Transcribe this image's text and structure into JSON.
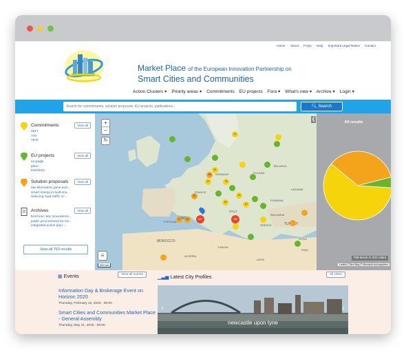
{
  "header": {
    "toplinks": [
      "Home",
      "About",
      "FAQs",
      "Help",
      "Important Legal Notice",
      "Contact"
    ],
    "title_main": "Market Place",
    "title_suffix": "of the European Innovation Partnership on",
    "title_line2": "Smart Cities and Communities",
    "nav": [
      "Action Clusters ▾",
      "Priority areas ▾",
      "Commitments",
      "EU projects",
      "Fora ▾",
      "What's new ▾",
      "Archive ▾",
      "Login ▾"
    ]
  },
  "search": {
    "placeholder": "Search for commitments, solution proposals, EU projects, publications...",
    "button_label": "Search"
  },
  "sidebar": {
    "commitments": {
      "title": "Commitments",
      "view_all": "View all",
      "items": [
        "4817",
        "770",
        "7570"
      ]
    },
    "eu_projects": {
      "title": "EU projects",
      "view_all": "View all",
      "items": [
        "eu-gugle",
        "pleec",
        "transform"
      ]
    },
    "solution_proposals": {
      "title": "Solution proposals",
      "view_all": "View all",
      "items": [
        "taxi kilometers, jams and...",
        "smart energy in built env...",
        "reducing road traffic re..."
      ]
    },
    "archives": {
      "title": "Archives",
      "view_all": "View all",
      "items": [
        "brochure: key innovations...",
        "public procurement for sm...",
        "integrated action plan -..."
      ]
    },
    "view_all_results": "View all 763 results"
  },
  "map": {
    "countries": [
      "FRANCE",
      "SPAIN",
      "PORTUGAL",
      "ITALY",
      "GERMANY",
      "POLAND",
      "UKRAINE",
      "BELARUS",
      "ROMANIA",
      "TURKEY",
      "GREECE",
      "MOROCCO",
      "ALGERIA",
      "TUNISIA",
      "LIBYA",
      "IRAQ",
      "SYRIA",
      "BULGARIA"
    ],
    "cluster_labels": [
      "11",
      "107",
      "126",
      "37",
      "79",
      "27",
      "39",
      "17",
      "20",
      "21",
      "22",
      "13",
      "12"
    ],
    "scale": "500 km"
  },
  "results": {
    "label": "All results",
    "items_count": "789 items in 322 cities",
    "attribution": "Leaflet | Tiles Bing © Microsoft and suppliers",
    "pie": [
      {
        "name": "commitments",
        "share": 0.6,
        "color": "#f6d40c"
      },
      {
        "name": "solution proposals",
        "share": 0.35,
        "color": "#f3a41a"
      },
      {
        "name": "eu projects",
        "share": 0.05,
        "color": "#67b42e"
      }
    ]
  },
  "events": {
    "title": "Events",
    "view_all": "View all events",
    "items": [
      {
        "title": "Information Day & Brokerage Event on Horizon 2020",
        "date": "Thursday, February 12, 2015 - 09:00"
      },
      {
        "title": "Smart Cities and Communities Market Place - General Assembly",
        "date": "Thursday, May 21, 2015 - 09:00"
      }
    ]
  },
  "city_profiles": {
    "title": "Latest City Profiles",
    "all_cities": "All cities",
    "caption": "newcastle upon tyne"
  }
}
